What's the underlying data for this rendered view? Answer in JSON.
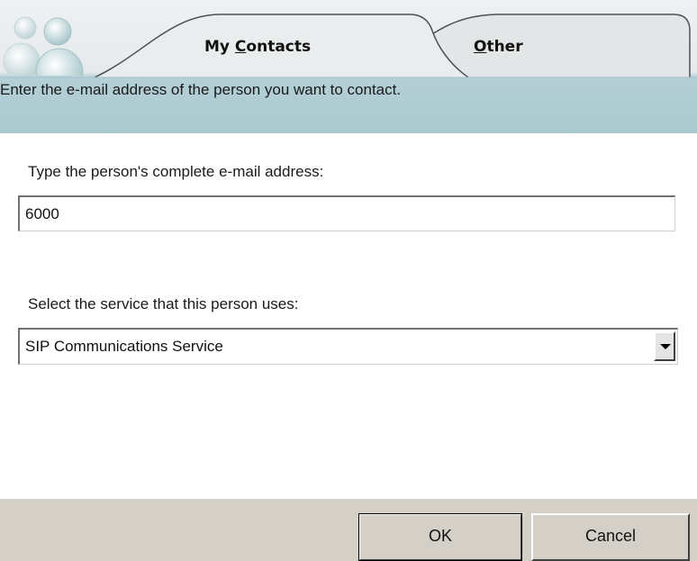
{
  "tabs": {
    "my_contacts": {
      "prefix": "My ",
      "accel": "C",
      "rest": "ontacts"
    },
    "other": {
      "prefix": "",
      "accel": "O",
      "rest": "ther"
    }
  },
  "header": {
    "instruction": "Enter the e-mail address of the person you want to contact."
  },
  "form": {
    "email_label": "Type the person's complete e-mail address:",
    "email_value": "6000",
    "service_label": "Select the service that this person uses:",
    "service_selected": "SIP Communications Service"
  },
  "buttons": {
    "ok": "OK",
    "cancel": "Cancel"
  },
  "icons": {
    "logo": "messenger-buddies-logo",
    "dropdown": "chevron-down-icon"
  },
  "colors": {
    "header_band": "#a8c9cf",
    "tab_surface": "#e6eaeb",
    "footer": "#d4d0c8"
  }
}
